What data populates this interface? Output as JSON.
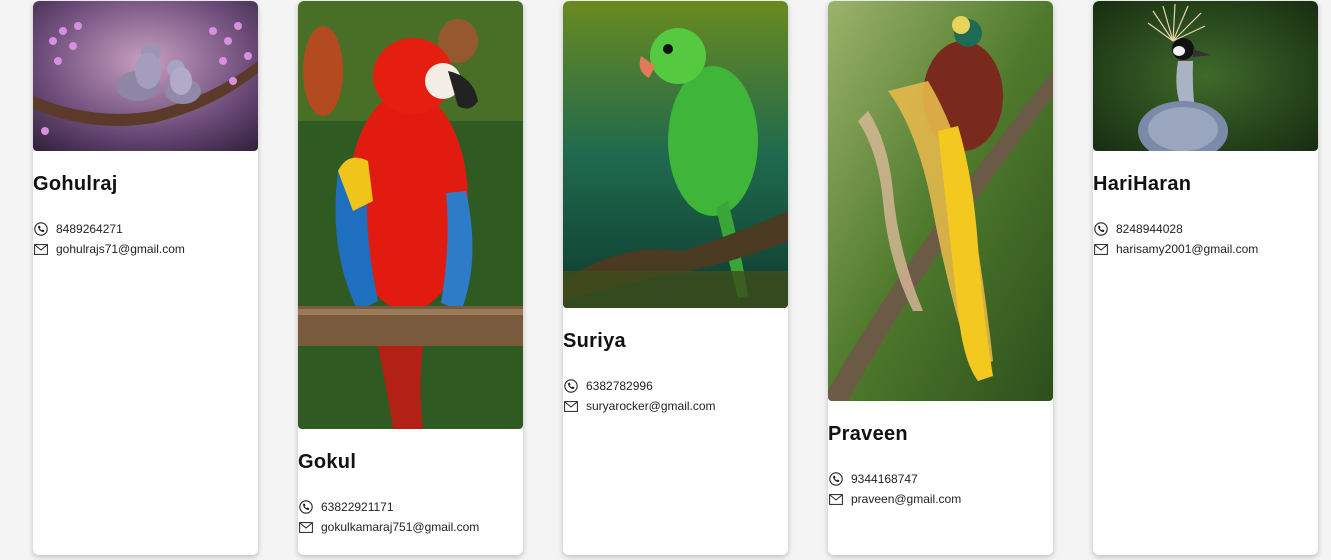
{
  "cards": [
    {
      "name": "Gohulraj",
      "phone": "8489264271",
      "email": "gohulrajs71@gmail.com",
      "image": "doves-on-branch",
      "phone_icon": "phone-icon",
      "email_icon": "mail-icon"
    },
    {
      "name": "Gokul",
      "phone": "63822921171",
      "email": "gokulkamaraj751@gmail.com",
      "image": "scarlet-macaw",
      "phone_icon": "phone-icon",
      "email_icon": "mail-icon"
    },
    {
      "name": "Suriya",
      "phone": "6382782996",
      "email": "suryarocker@gmail.com",
      "image": "green-parakeet",
      "phone_icon": "phone-icon",
      "email_icon": "mail-icon"
    },
    {
      "name": "Praveen",
      "phone": "9344168747",
      "email": "praveen@gmail.com",
      "image": "bird-of-paradise",
      "phone_icon": "phone-icon",
      "email_icon": "mail-icon"
    },
    {
      "name": "HariHaran",
      "phone": "8248944028",
      "email": "harisamy2001@gmail.com",
      "image": "crowned-crane",
      "phone_icon": "phone-icon",
      "email_icon": "mail-icon"
    }
  ]
}
